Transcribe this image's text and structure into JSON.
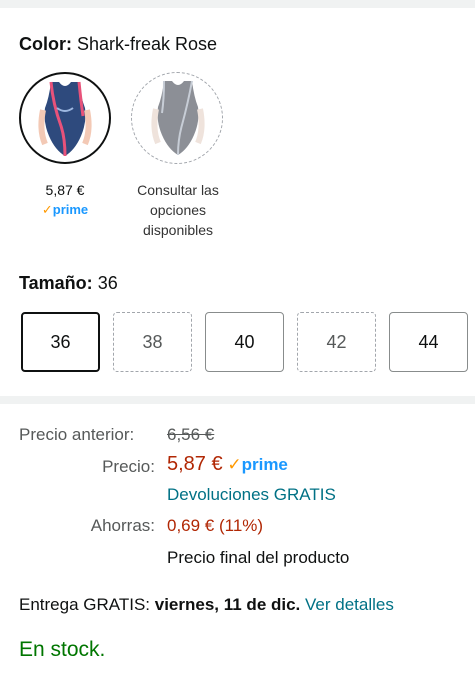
{
  "color": {
    "label": "Color:",
    "value": "Shark-freak Rose",
    "swatches": [
      {
        "price": "5,87 €",
        "prime_label": "prime",
        "prime_check": "✓",
        "state": "selected"
      },
      {
        "caption_lines": [
          "Consultar las",
          "opciones",
          "disponibles"
        ],
        "state": "unavailable"
      }
    ]
  },
  "size": {
    "label": "Tamaño:",
    "value": "36",
    "options": [
      {
        "label": "36",
        "state": "selected"
      },
      {
        "label": "38",
        "state": "unavailable"
      },
      {
        "label": "40",
        "state": "available"
      },
      {
        "label": "42",
        "state": "unavailable"
      },
      {
        "label": "44",
        "state": "available"
      }
    ]
  },
  "pricing": {
    "previous_label": "Precio anterior:",
    "previous_value": "6,56 €",
    "price_label": "Precio:",
    "price_value": "5,87 €",
    "prime_check": "✓",
    "prime_label": "prime",
    "returns_link": "Devoluciones GRATIS",
    "savings_label": "Ahorras:",
    "savings_value": "0,69 € (11%)",
    "final_price_note": "Precio final del producto"
  },
  "delivery": {
    "prefix": "Entrega GRATIS:",
    "date": "viernes, 11 de dic.",
    "details_link": "Ver detalles"
  },
  "stock": {
    "status": "En stock."
  },
  "colors": {
    "price_red": "#b12704",
    "link_teal": "#007185",
    "stock_green": "#007600",
    "prime_blue": "#1a98ff",
    "prime_check_orange": "#ff9900"
  }
}
